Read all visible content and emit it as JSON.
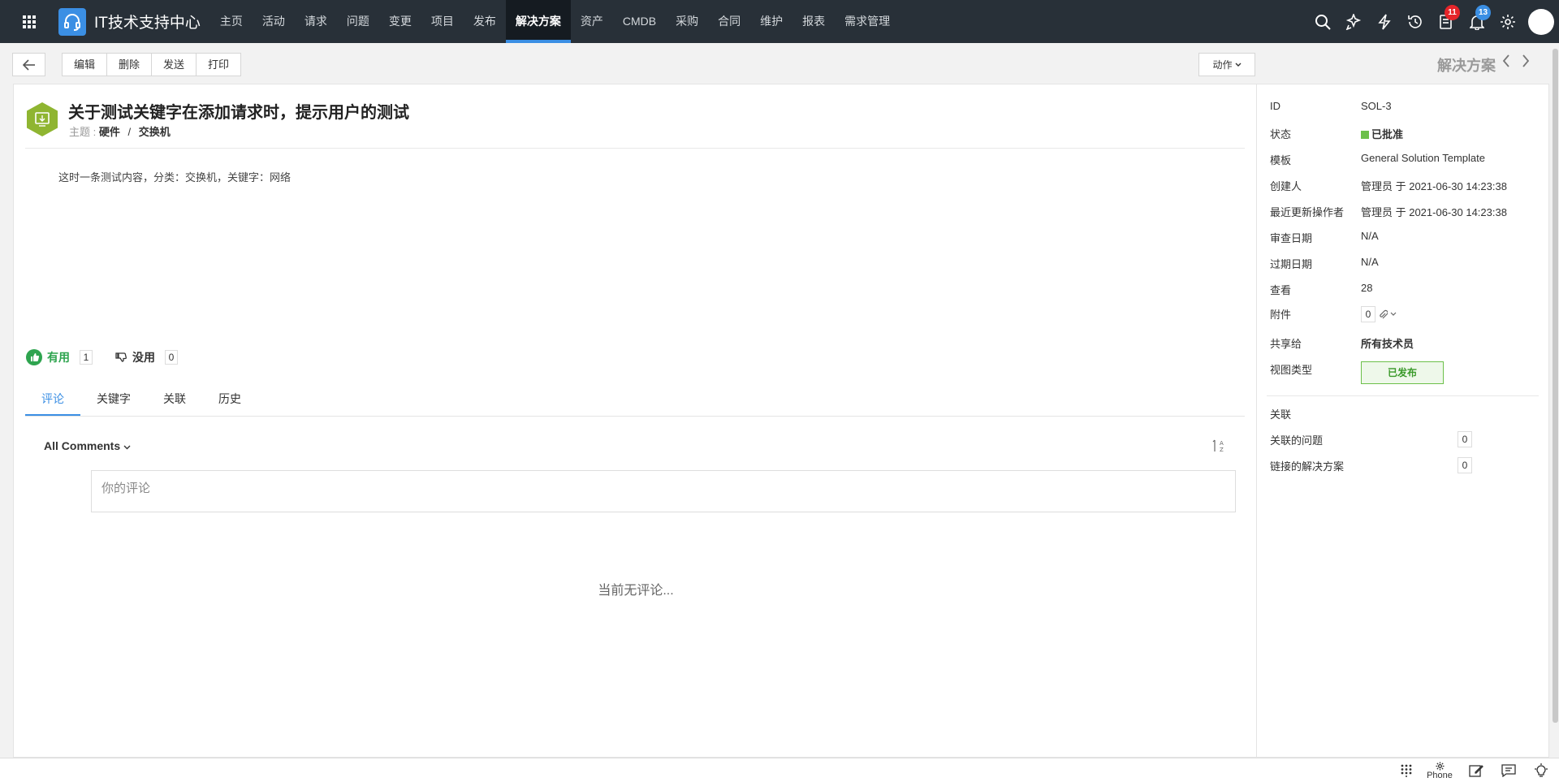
{
  "topnav": {
    "brand": "IT技术支持中心",
    "menu": [
      "主页",
      "活动",
      "请求",
      "问题",
      "变更",
      "项目",
      "发布",
      "解决方案",
      "资产",
      "CMDB",
      "采购",
      "合同",
      "维护",
      "报表",
      "需求管理"
    ],
    "active_menu": "解决方案",
    "badges": {
      "tasks": "11",
      "notifications": "13"
    }
  },
  "toolbar": {
    "edit": "编辑",
    "delete": "删除",
    "send": "发送",
    "print": "打印",
    "actions": "动作",
    "section_title": "解决方案"
  },
  "solution": {
    "title": "关于测试关键字在添加请求时，提示用户的测试",
    "subject_label": "主题 :",
    "subject_category": "硬件",
    "subject_separator": "/",
    "subject_subcategory": "交换机",
    "description": "这时一条测试内容，分类：交换机，关键字：网络"
  },
  "votes": {
    "useful_label": "有用",
    "useful_count": "1",
    "useless_label": "没用",
    "useless_count": "0"
  },
  "tabs": [
    "评论",
    "关键字",
    "关联",
    "历史"
  ],
  "comments": {
    "filter": "All Comments",
    "placeholder": "你的评论",
    "empty": "当前无评论..."
  },
  "properties": {
    "id": {
      "label": "ID",
      "value": "SOL-3"
    },
    "status": {
      "label": "状态",
      "value": "已批准",
      "color": "#6cc04a"
    },
    "template": {
      "label": "模板",
      "value": "General Solution Template"
    },
    "creator": {
      "label": "创建人",
      "value": "管理员 于 2021-06-30 14:23:38"
    },
    "updater": {
      "label": "最近更新操作者",
      "value": "管理员 于 2021-06-30 14:23:38"
    },
    "review_date": {
      "label": "审查日期",
      "value": "N/A"
    },
    "expiry_date": {
      "label": "过期日期",
      "value": "N/A"
    },
    "views": {
      "label": "查看",
      "value": "28"
    },
    "attachments": {
      "label": "附件",
      "value": "0"
    },
    "shared_with": {
      "label": "共享给",
      "value": "所有技术员"
    },
    "view_type": {
      "label": "视图类型",
      "value": "已发布"
    }
  },
  "relations": {
    "title": "关联",
    "problems": {
      "label": "关联的问题",
      "value": "0"
    },
    "solutions": {
      "label": "链接的解决方案",
      "value": "0"
    }
  },
  "bottombar": {
    "phone": "Phone"
  }
}
